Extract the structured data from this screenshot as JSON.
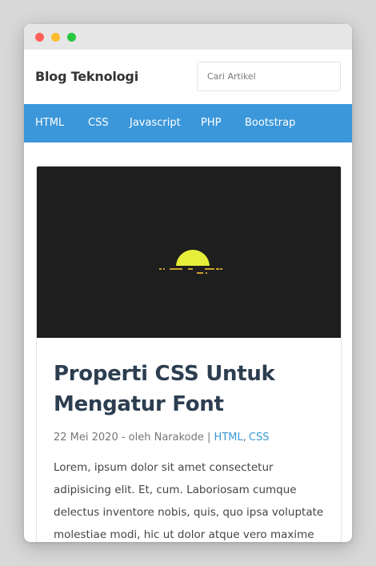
{
  "site": {
    "title": "Blog Teknologi"
  },
  "search": {
    "placeholder": "Cari Artikel"
  },
  "nav": {
    "items": [
      "HTML",
      "CSS",
      "Javascript",
      "PHP",
      "Bootstrap"
    ]
  },
  "post": {
    "title": "Properti CSS Untuk Mengatur Font",
    "date": "22 Mei 2020",
    "author_prefix": " - oleh ",
    "author": "Narakode",
    "separator": " | ",
    "categories": [
      "HTML",
      "CSS"
    ],
    "category_sep": ",",
    "excerpt": "Lorem, ipsum dolor sit amet consectetur adipisicing elit. Et, cum. Laboriosam cumque delectus inventore nobis, quis, quo ipsa voluptate molestiae modi, hic ut dolor atque vero maxime"
  },
  "colors": {
    "accent": "#3b97d9",
    "title_text": "#2c3e50",
    "thumbnail_bg": "#1e1e1e",
    "sun": "#e6ee3a",
    "ground_lines": "#c9a12b"
  }
}
